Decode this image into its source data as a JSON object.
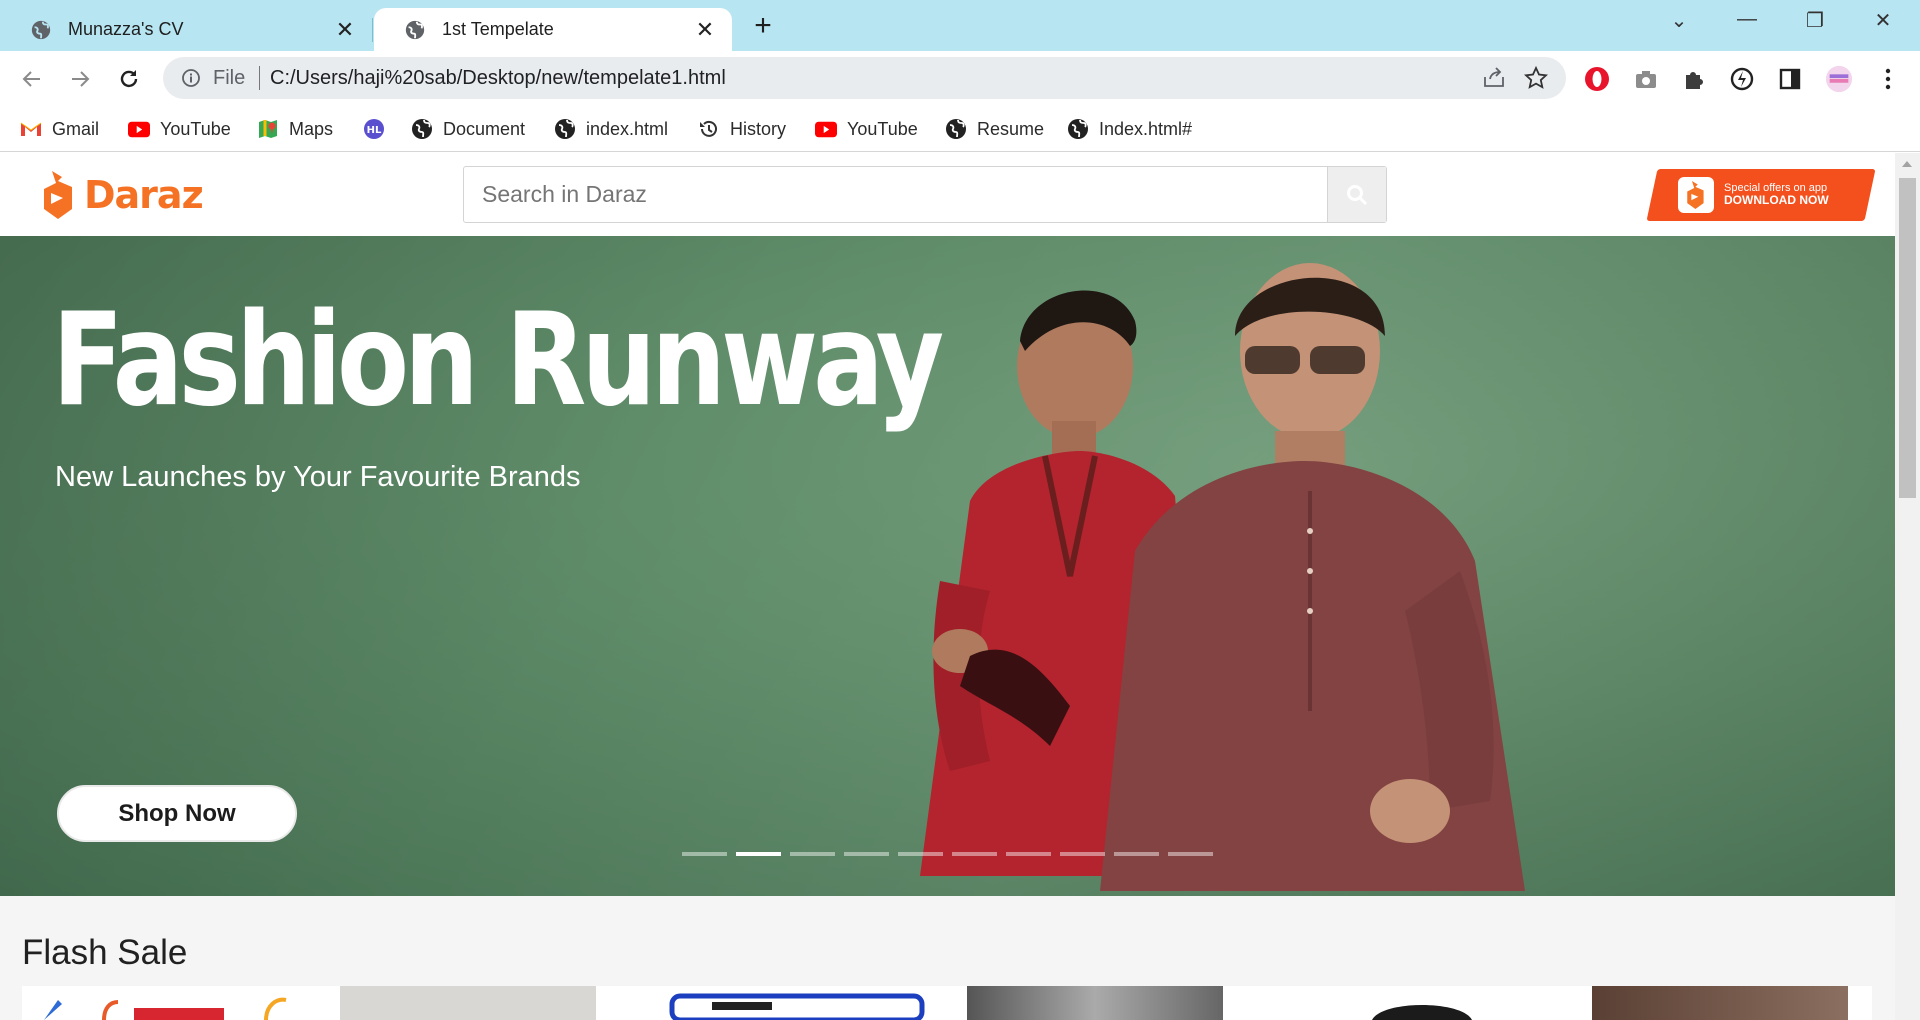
{
  "browser": {
    "tabs": [
      {
        "title": "Munazza's CV",
        "active": false
      },
      {
        "title": "1st Tempelate",
        "active": true
      }
    ],
    "address": {
      "scheme": "File",
      "url": "C:/Users/haji%20sab/Desktop/new/tempelate1.html"
    },
    "bookmarks": [
      {
        "label": "Gmail",
        "icon": "gmail-icon"
      },
      {
        "label": "YouTube",
        "icon": "youtube-icon"
      },
      {
        "label": "Maps",
        "icon": "maps-icon"
      },
      {
        "label": "",
        "icon": "hl-icon"
      },
      {
        "label": "Document",
        "icon": "globe-icon"
      },
      {
        "label": "index.html",
        "icon": "globe-icon"
      },
      {
        "label": "History",
        "icon": "history-icon"
      },
      {
        "label": "YouTube",
        "icon": "youtube-icon"
      },
      {
        "label": "Resume",
        "icon": "globe-icon"
      },
      {
        "label": "Index.html#",
        "icon": "globe-icon"
      }
    ]
  },
  "site": {
    "logo_text": "Daraz",
    "search_placeholder": "Search in Daraz",
    "app_badge": {
      "line1": "Special offers on app",
      "line2": "DOWNLOAD NOW"
    }
  },
  "hero": {
    "title": "Fashion Runway",
    "subtitle": "New Launches by Your Favourite Brands",
    "cta": "Shop Now",
    "slide_count": 10,
    "active_slide": 2
  },
  "flash_sale": {
    "title": "Flash Sale"
  },
  "colors": {
    "brand": "#f57224",
    "tabstrip": "#b8e5f2",
    "hero_bg": "#5f8c69"
  }
}
